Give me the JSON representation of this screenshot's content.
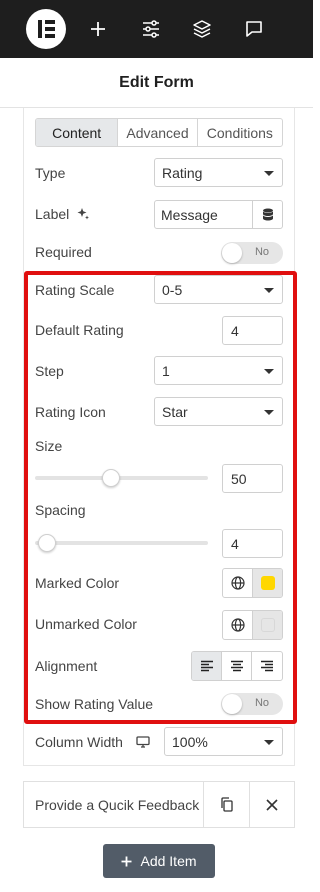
{
  "header": {
    "title": "Edit Form",
    "icons": [
      "elementor-logo-icon",
      "plus-icon",
      "sliders-icon",
      "layers-icon",
      "chat-icon"
    ]
  },
  "tabs": [
    "Content",
    "Advanced",
    "Conditions"
  ],
  "fields": {
    "type": {
      "label": "Type",
      "value": "Rating"
    },
    "label": {
      "label": "Label",
      "value": "Message"
    },
    "required": {
      "label": "Required",
      "toggle": "No"
    },
    "rating_scale": {
      "label": "Rating Scale",
      "value": "0-5"
    },
    "default_rating": {
      "label": "Default Rating",
      "value": "4"
    },
    "step": {
      "label": "Step",
      "value": "1"
    },
    "rating_icon": {
      "label": "Rating Icon",
      "value": "Star"
    },
    "size": {
      "label": "Size",
      "value": "50"
    },
    "spacing": {
      "label": "Spacing",
      "value": "4"
    },
    "marked_color": {
      "label": "Marked Color",
      "color": "#FFD700"
    },
    "unmarked_color": {
      "label": "Unmarked Color",
      "color": "#E6E6E6"
    },
    "alignment": {
      "label": "Alignment",
      "selected": "left"
    },
    "show_rating_value": {
      "label": "Show Rating Value",
      "toggle": "No"
    },
    "column_width": {
      "label": "Column Width",
      "value": "100%"
    }
  },
  "feedback_item": {
    "label": "Provide a Qucik Feedback"
  },
  "add_item": {
    "label": "Add Item"
  },
  "colors": {
    "highlight": "#E00F0F",
    "topbar": "#1E1E1E",
    "button": "#525C68"
  }
}
